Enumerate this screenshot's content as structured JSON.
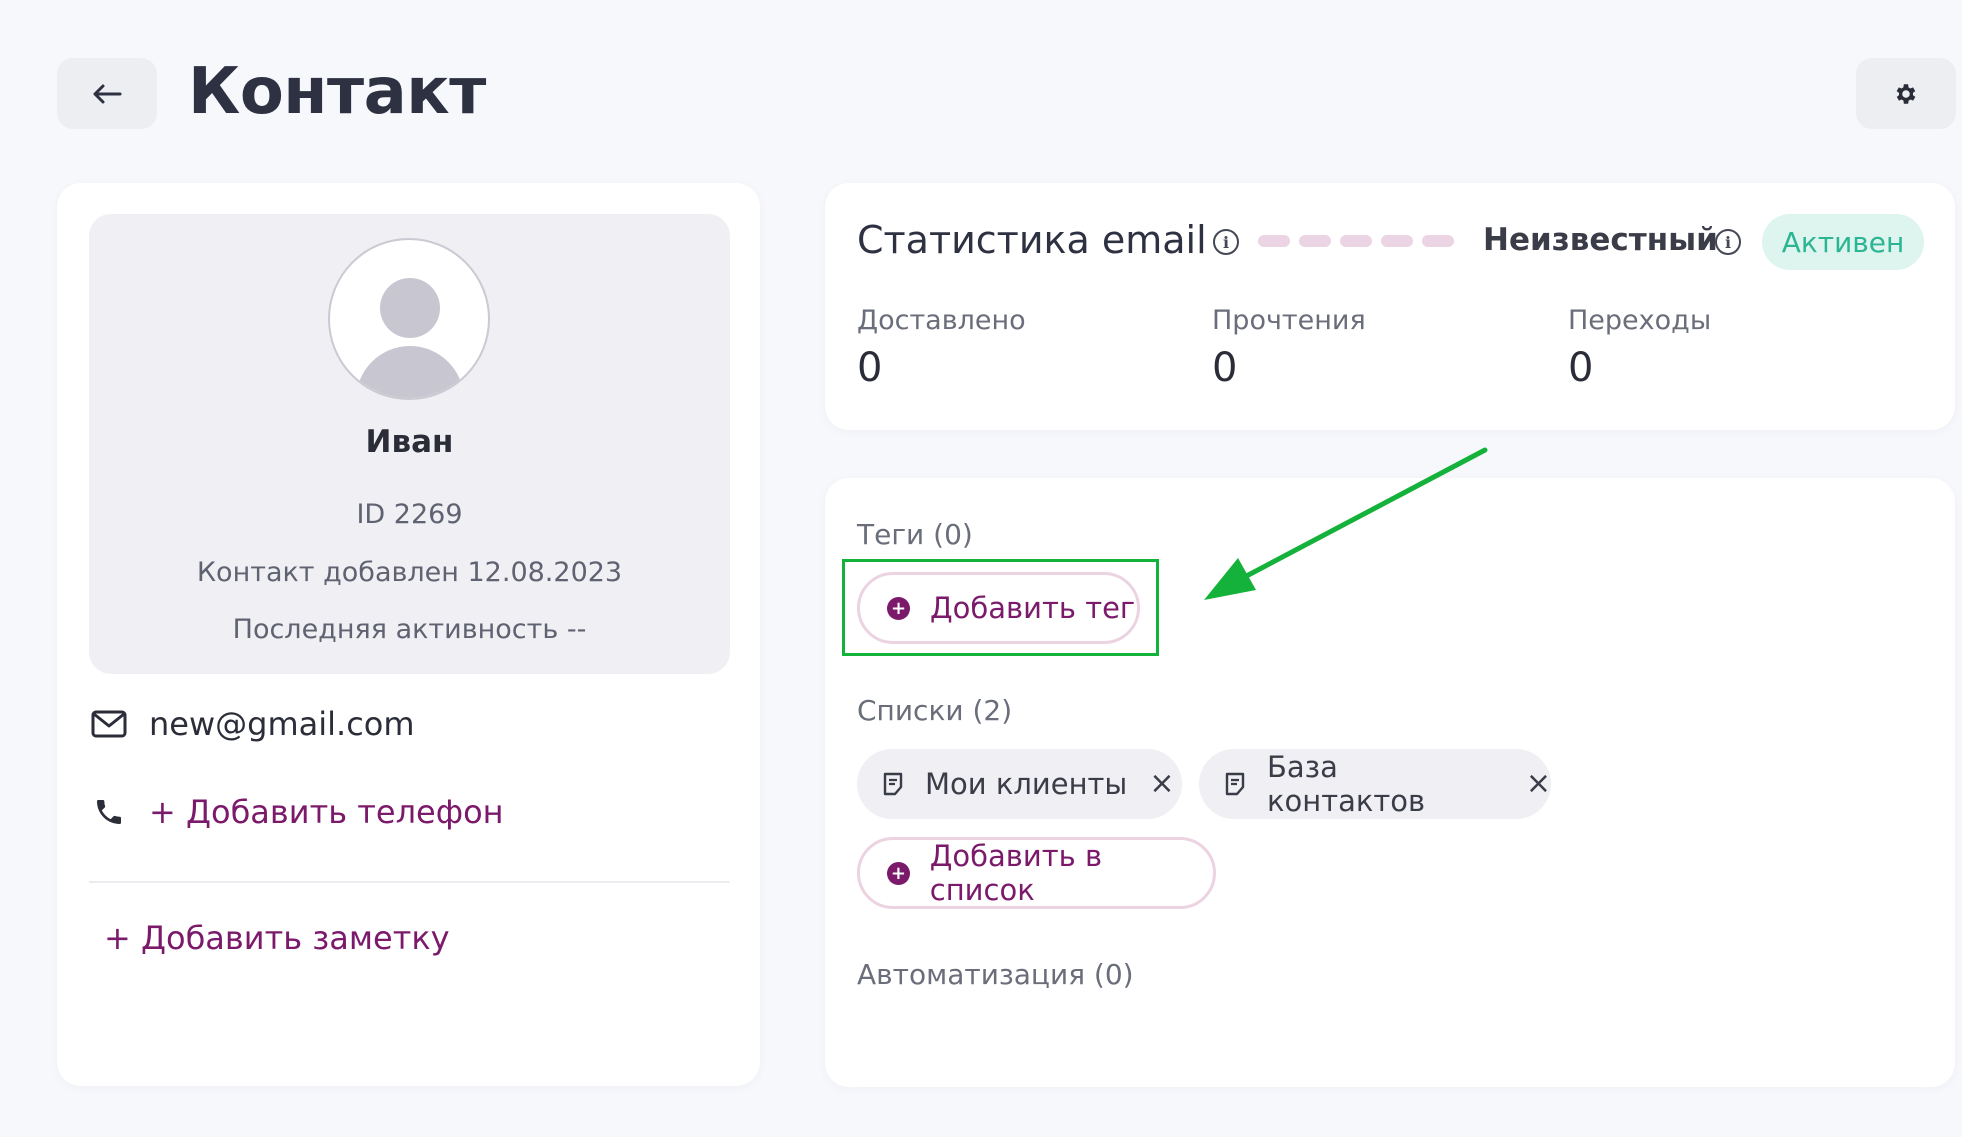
{
  "header": {
    "title": "Контакт",
    "back_icon": "arrow-left-icon",
    "settings_icon": "gear-icon"
  },
  "profile": {
    "name": "Иван",
    "id_text": "ID 2269",
    "added_text": "Контакт добавлен 12.08.2023",
    "activity_text": "Последняя активность --",
    "email": "new@gmail.com",
    "add_phone": "+ Добавить телефон",
    "add_note": "+ Добавить заметку"
  },
  "stats": {
    "title": "Статистика email",
    "status": "Неизвестный",
    "badge": "Активен",
    "badge_color": "#2bb593",
    "metrics": [
      {
        "label": "Доставлено",
        "value": "0"
      },
      {
        "label": "Прочтения",
        "value": "0"
      },
      {
        "label": "Переходы",
        "value": "0"
      }
    ]
  },
  "tags": {
    "label": "Теги (0)",
    "add_button": "Добавить тег"
  },
  "lists": {
    "label": "Списки (2)",
    "items": [
      {
        "name": "Мои клиенты"
      },
      {
        "name": "База контактов"
      }
    ],
    "add_button": "Добавить в список"
  },
  "automation": {
    "label": "Автоматизация (0)"
  },
  "colors": {
    "accent": "#7b1a6b",
    "highlight": "#13b23b",
    "background": "#f7f8fc"
  }
}
